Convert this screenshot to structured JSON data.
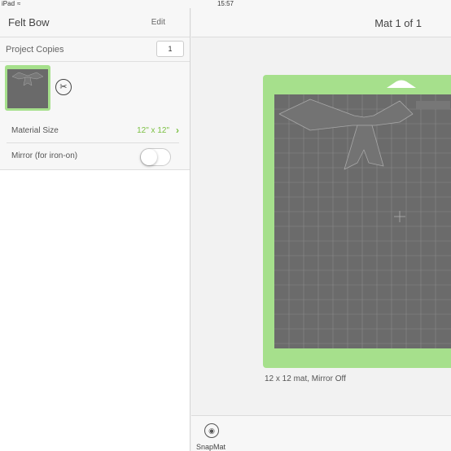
{
  "status_bar": {
    "carrier": "iPad",
    "time": "15:57"
  },
  "left_panel": {
    "title": "Felt Bow",
    "edit_label": "Edit",
    "copies_label": "Project Copies",
    "copies_value": "1",
    "material_size_label": "Material Size",
    "material_size_value": "12\" x 12\"",
    "mirror_label": "Mirror (for iron-on)",
    "mirror_on": false
  },
  "right_panel": {
    "title": "Mat 1 of 1",
    "mat_caption": "12 x 12 mat, Mirror Off"
  },
  "bottom_bar": {
    "snapmat_label": "SnapMat"
  },
  "colors": {
    "accent": "#7cc043",
    "mat_green": "#a6e08c",
    "mat_grey": "#6b6b6b"
  },
  "icons": {
    "wifi": "wifi-icon",
    "cut": "scissors-icon",
    "chevron": "chevron-right-icon",
    "snapmat": "camera-icon"
  }
}
